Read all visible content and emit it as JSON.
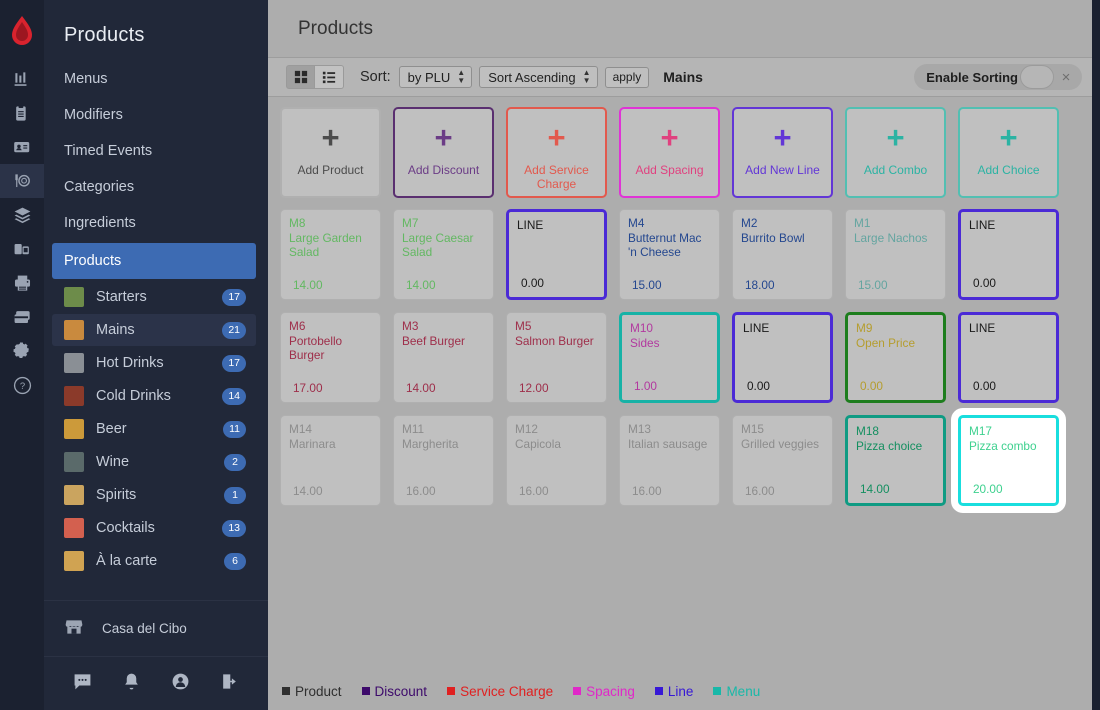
{
  "window": {
    "background": "#1b2130"
  },
  "rail": {
    "icons": [
      {
        "name": "reports-chart-icon",
        "active": false
      },
      {
        "name": "clipboard-icon",
        "active": false
      },
      {
        "name": "id-card-icon",
        "active": false
      },
      {
        "name": "menu-dish-icon",
        "active": true
      },
      {
        "name": "layers-icon",
        "active": false
      },
      {
        "name": "devices-icon",
        "active": false
      },
      {
        "name": "printer-icon",
        "active": false
      },
      {
        "name": "payment-card-icon",
        "active": false
      },
      {
        "name": "gear-icon",
        "active": false
      },
      {
        "name": "help-icon",
        "active": false
      }
    ]
  },
  "sidebar": {
    "title": "Products",
    "links": [
      {
        "label": "Menus",
        "selected": false
      },
      {
        "label": "Modifiers",
        "selected": false
      },
      {
        "label": "Timed Events",
        "selected": false
      },
      {
        "label": "Categories",
        "selected": false
      },
      {
        "label": "Ingredients",
        "selected": false
      },
      {
        "label": "Products",
        "selected": true
      }
    ],
    "categories": [
      {
        "label": "Starters",
        "count": "17",
        "selected": false,
        "thumb": "#6d8c4a"
      },
      {
        "label": "Mains",
        "count": "21",
        "selected": true,
        "thumb": "#c98a3e"
      },
      {
        "label": "Hot Drinks",
        "count": "17",
        "selected": false,
        "thumb": "#8a8f95"
      },
      {
        "label": "Cold Drinks",
        "count": "14",
        "selected": false,
        "thumb": "#8b3a2a"
      },
      {
        "label": "Beer",
        "count": "11",
        "selected": false,
        "thumb": "#cc9a3a"
      },
      {
        "label": "Wine",
        "count": "2",
        "selected": false,
        "thumb": "#5a6a6a"
      },
      {
        "label": "Spirits",
        "count": "1",
        "selected": false,
        "thumb": "#caa45f"
      },
      {
        "label": "Cocktails",
        "count": "13",
        "selected": false,
        "thumb": "#d3604f"
      },
      {
        "label": "À la carte",
        "count": "6",
        "selected": false,
        "thumb": "#d0a352"
      }
    ],
    "store": {
      "label": "Casa del Cibo",
      "icon": "store-icon"
    },
    "bottom_icons": [
      {
        "name": "messages-icon"
      },
      {
        "name": "notifications-bell-icon"
      },
      {
        "name": "user-account-icon"
      },
      {
        "name": "logout-icon"
      }
    ]
  },
  "header": {
    "title": "Products"
  },
  "toolbar": {
    "view_grid_icon": "grid-view-icon",
    "view_list_icon": "list-view-icon",
    "grid_selected": true,
    "sort_label": "Sort:",
    "sort_field_value": "by PLU",
    "sort_order_value": "Sort Ascending",
    "apply_label": "apply",
    "current_category": "Mains",
    "enable_sorting_label": "Enable Sorting",
    "sorting_enabled": false,
    "close_label": "×"
  },
  "add_buttons": [
    {
      "label": "Add Product",
      "color": "#4c4c4c",
      "border": "#b0b0b0"
    },
    {
      "label": "Add Discount",
      "color": "#6b3c86",
      "border": "#5a2f70"
    },
    {
      "label": "Add Service Charge",
      "color": "#e2594d",
      "border": "#e2594d"
    },
    {
      "label": "Add Spacing",
      "color": "#e0417f",
      "border": "#e033d6"
    },
    {
      "label": "Add New Line",
      "color": "#6236d6",
      "border": "#6236d6"
    },
    {
      "label": "Add Combo",
      "color": "#2bb3a3",
      "border": "#52bfb2"
    },
    {
      "label": "Add Choice",
      "color": "#2bb3a3",
      "border": "#52bfb2"
    }
  ],
  "grid": {
    "rows": [
      [
        {
          "type": "product",
          "plu": "M8",
          "name": "Large Garden Salad",
          "price": "14.00",
          "color": "#63b862",
          "border": "#b0b0b0",
          "selected": false
        },
        {
          "type": "product",
          "plu": "M7",
          "name": "Large Caesar Salad",
          "price": "14.00",
          "color": "#63b862",
          "border": "#b0b0b0",
          "selected": false
        },
        {
          "type": "line",
          "plu": "LINE",
          "name": "",
          "price": "0.00",
          "color": "#1a1a1a",
          "border": "#4b2ad6",
          "selected": false
        },
        {
          "type": "product",
          "plu": "M4",
          "name": "Butternut Mac 'n Cheese",
          "price": "15.00",
          "color": "#24478f",
          "border": "#b0b0b0",
          "selected": false
        },
        {
          "type": "product",
          "plu": "M2",
          "name": "Burrito Bowl",
          "price": "18.00",
          "color": "#24478f",
          "border": "#b0b0b0",
          "selected": false
        },
        {
          "type": "product",
          "plu": "M1",
          "name": "Large Nachos",
          "price": "15.00",
          "color": "#64a5a0",
          "border": "#b0b0b0",
          "selected": false
        },
        {
          "type": "line",
          "plu": "LINE",
          "name": "",
          "price": "0.00",
          "color": "#1a1a1a",
          "border": "#4b2ad6",
          "selected": false
        }
      ],
      [
        {
          "type": "product",
          "plu": "M6",
          "name": "Portobello Burger",
          "price": "17.00",
          "color": "#9e2e4a",
          "border": "#b0b0b0",
          "selected": false
        },
        {
          "type": "product",
          "plu": "M3",
          "name": "Beef Burger",
          "price": "14.00",
          "color": "#9e2e4a",
          "border": "#b0b0b0",
          "selected": false
        },
        {
          "type": "product",
          "plu": "M5",
          "name": "Salmon Burger",
          "price": "12.00",
          "color": "#9e2e4a",
          "border": "#b0b0b0",
          "selected": false
        },
        {
          "type": "menu",
          "plu": "M10",
          "name": "Sides",
          "price": "1.00",
          "color": "#b2399f",
          "border": "#17b2a6",
          "selected": false
        },
        {
          "type": "line",
          "plu": "LINE",
          "name": "",
          "price": "0.00",
          "color": "#1a1a1a",
          "border": "#4b2ad6",
          "selected": false
        },
        {
          "type": "product",
          "plu": "M9",
          "name": "Open Price",
          "price": "0.00",
          "color": "#b59d2e",
          "border": "#1d7d1d",
          "selected": false
        },
        {
          "type": "line",
          "plu": "LINE",
          "name": "",
          "price": "0.00",
          "color": "#1a1a1a",
          "border": "#4b2ad6",
          "selected": false
        }
      ],
      [
        {
          "type": "product",
          "plu": "M14",
          "name": "Marinara",
          "price": "14.00",
          "color": "#8c8c8c",
          "border": "#b0b0b0",
          "selected": false
        },
        {
          "type": "product",
          "plu": "M11",
          "name": "Margherita",
          "price": "16.00",
          "color": "#8c8c8c",
          "border": "#b0b0b0",
          "selected": false
        },
        {
          "type": "product",
          "plu": "M12",
          "name": "Capicola",
          "price": "16.00",
          "color": "#8c8c8c",
          "border": "#b0b0b0",
          "selected": false
        },
        {
          "type": "product",
          "plu": "M13",
          "name": "Italian sausage",
          "price": "16.00",
          "color": "#8c8c8c",
          "border": "#b0b0b0",
          "selected": false
        },
        {
          "type": "product",
          "plu": "M15",
          "name": "Grilled veggies",
          "price": "16.00",
          "color": "#8c8c8c",
          "border": "#b0b0b0",
          "selected": false
        },
        {
          "type": "combo",
          "plu": "M18",
          "name": "Pizza choice",
          "price": "14.00",
          "color": "#148f60",
          "border": "#0f9b83",
          "selected": false
        },
        {
          "type": "combo",
          "plu": "M17",
          "name": "Pizza combo",
          "price": "20.00",
          "color": "#3ed18f",
          "border": "#19dede",
          "selected": true
        }
      ]
    ]
  },
  "legend": [
    {
      "label": "Product",
      "color": "#2f2f2f"
    },
    {
      "label": "Discount",
      "color": "#3d0a6b"
    },
    {
      "label": "Service Charge",
      "color": "#e02020"
    },
    {
      "label": "Spacing",
      "color": "#e028c8"
    },
    {
      "label": "Line",
      "color": "#3618d6"
    },
    {
      "label": "Menu",
      "color": "#18b8a8"
    }
  ]
}
